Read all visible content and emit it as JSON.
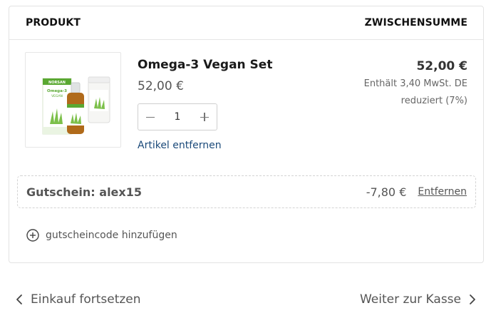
{
  "header": {
    "product_col": "PRODUKT",
    "subtotal_col": "ZWISCHENSUMME"
  },
  "item": {
    "name": "Omega-3 Vegan Set",
    "price": "52,00 €",
    "quantity": "1",
    "remove_label": "Artikel entfernen",
    "subtotal": "52,00 €",
    "tax_line1": "Enthält 3,40  MwSt. DE",
    "tax_line2": "reduziert (7%)",
    "image_text": {
      "brand": "NORSAN",
      "title": "Omega-3",
      "subtitle": "VEGAN"
    },
    "image_colors": {
      "green": "#5aa832",
      "amber": "#b06a1a"
    }
  },
  "coupon": {
    "label": "Gutschein: alex15",
    "amount": "-7,80 €",
    "remove_label": "Entfernen"
  },
  "add_code": {
    "label": "gutscheincode hinzufügen",
    "icon": "plus-circle-icon"
  },
  "footer": {
    "back_label": "Einkauf fortsetzen",
    "next_label": "Weiter zur Kasse",
    "back_icon": "chevron-left-icon",
    "next_icon": "chevron-right-icon"
  }
}
